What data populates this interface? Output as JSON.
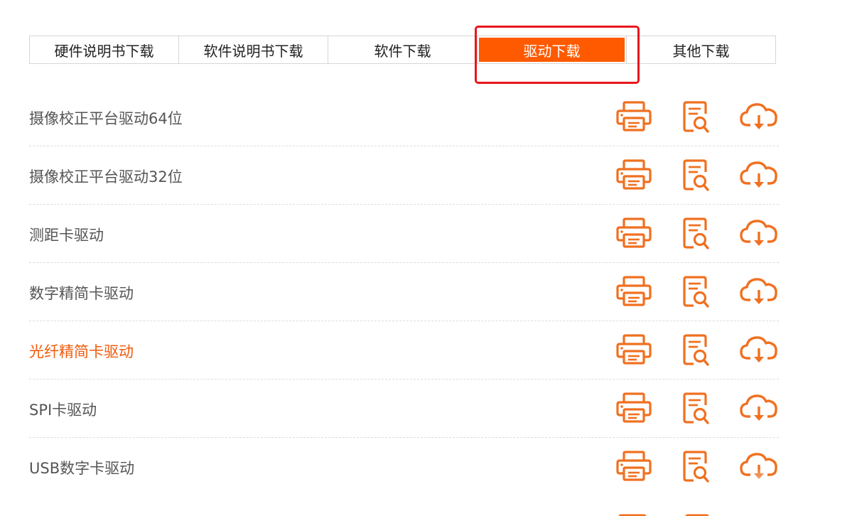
{
  "tabs": [
    {
      "label": "硬件说明书下载",
      "active": false
    },
    {
      "label": "软件说明书下载",
      "active": false
    },
    {
      "label": "软件下载",
      "active": false
    },
    {
      "label": "驱动下载",
      "active": true
    },
    {
      "label": "其他下载",
      "active": false
    }
  ],
  "rows": [
    {
      "name": "摄像校正平台驱动64位",
      "highlighted": false
    },
    {
      "name": "摄像校正平台驱动32位",
      "highlighted": false
    },
    {
      "name": "测距卡驱动",
      "highlighted": false
    },
    {
      "name": "数字精简卡驱动",
      "highlighted": false
    },
    {
      "name": "光纤精简卡驱动",
      "highlighted": true
    },
    {
      "name": "SPI卡驱动",
      "highlighted": false
    },
    {
      "name": "USB数字卡驱动",
      "highlighted": false
    }
  ],
  "row_actions": [
    "printer-icon",
    "document-search-icon",
    "cloud-download-icon"
  ],
  "colors": {
    "accent": "#ff5a00",
    "icon": "#f07020",
    "highlight_border": "#e8161c",
    "text": "#555555",
    "highlight_text": "#f05a0a"
  }
}
